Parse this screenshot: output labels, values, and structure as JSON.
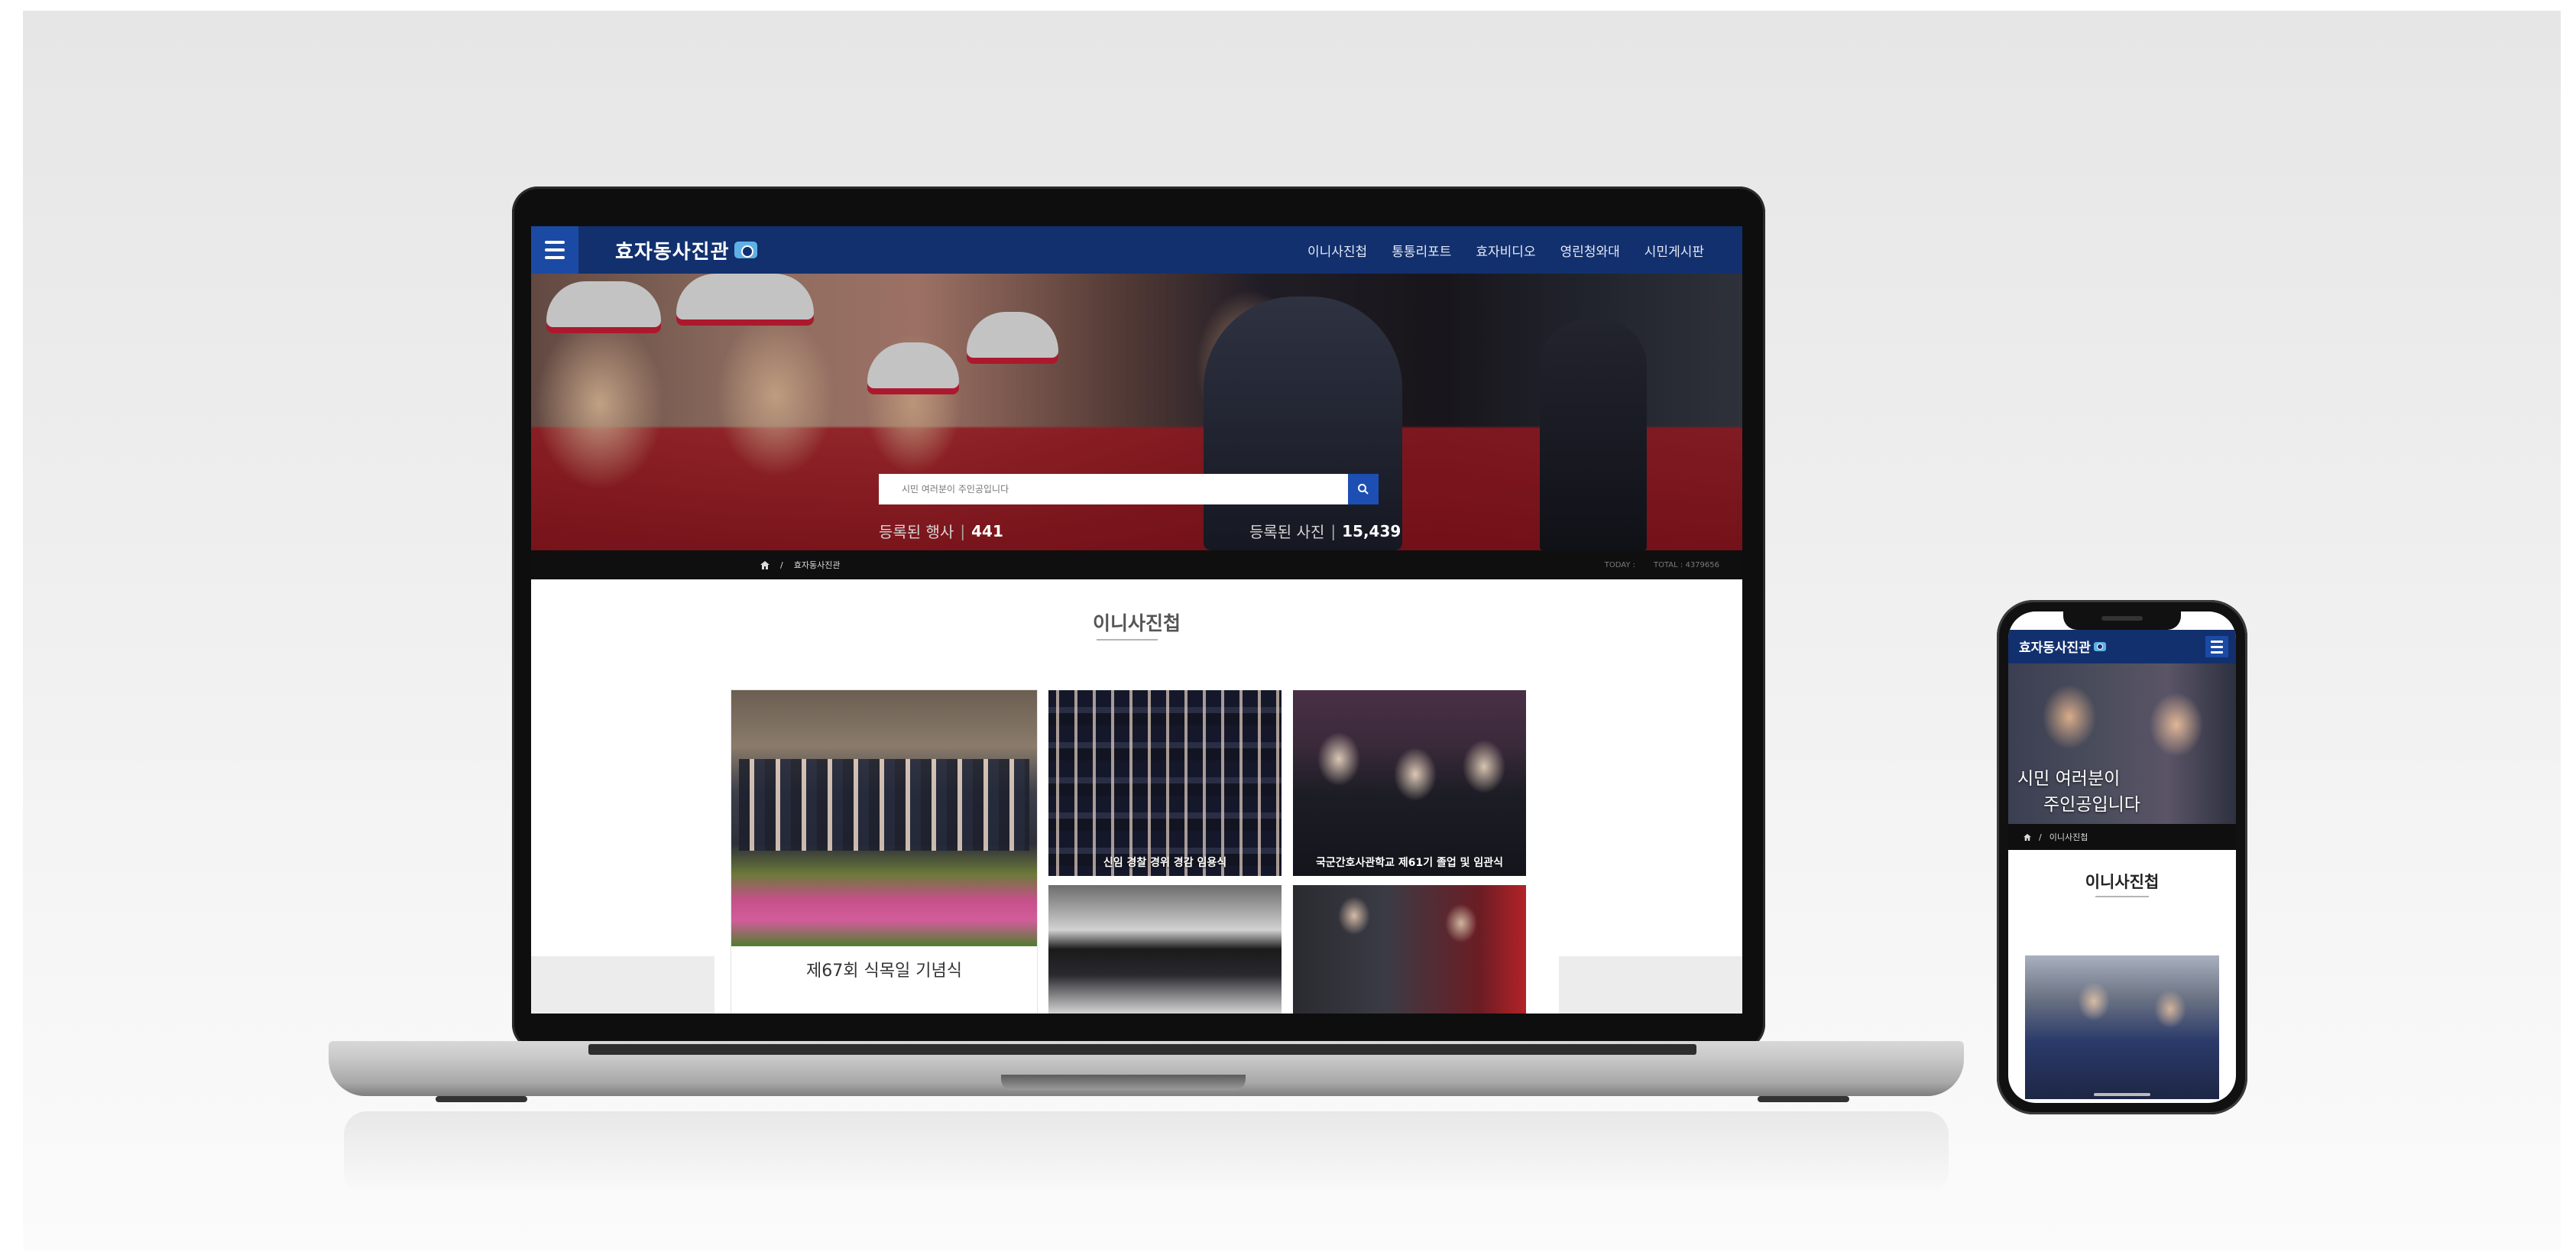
{
  "brand": {
    "logo_text": "효자동사진관",
    "header_color": "#12306e",
    "accent_color": "#1b4aa5"
  },
  "desktop": {
    "nav": [
      "이니사진첩",
      "통통리포트",
      "효자비디오",
      "영린청와대",
      "시민게시판"
    ],
    "search": {
      "placeholder": "시민 여러분이 주인공입니다"
    },
    "stats": {
      "events_label": "등록된 행사",
      "events_value": "441",
      "photos_label": "등록된 사진",
      "photos_value": "15,439"
    },
    "breadcrumb": {
      "home_icon": "home-icon",
      "separator": "/",
      "current": "효자동사진관"
    },
    "counter": {
      "today": "TODAY :",
      "total": "TOTAL : 4379656"
    },
    "section_title": "이니사진첩",
    "cards": {
      "main_caption": "제67회 식목일 기념식",
      "a_caption": "신임 경찰 경위 경감 임용식",
      "b_caption": "국군간호사관학교 제61기 졸업 및 임관식",
      "c_caption": "",
      "d_caption": ""
    }
  },
  "mobile": {
    "logo_text": "효자동사진관",
    "hero_line1": "시민 여러분이",
    "hero_line2": "주인공입니다",
    "breadcrumb_separator": "/",
    "breadcrumb_current": "이니사진첩",
    "section_title": "이니사진첩"
  }
}
